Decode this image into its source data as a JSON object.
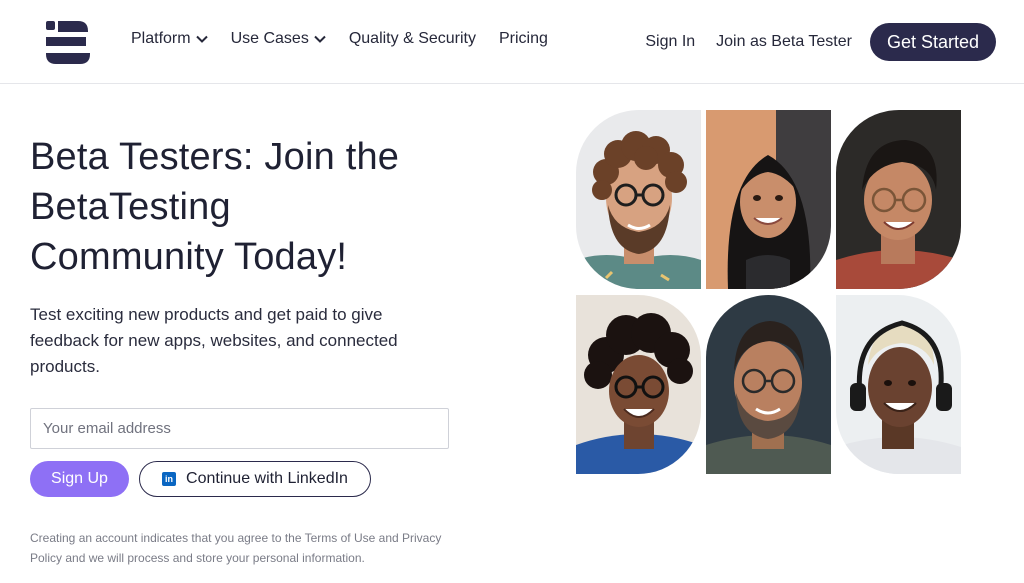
{
  "header": {
    "logo_icon": "betatesting-logo-icon",
    "nav": [
      {
        "label": "Platform",
        "has_dropdown": true
      },
      {
        "label": "Use Cases",
        "has_dropdown": true
      },
      {
        "label": "Quality & Security",
        "has_dropdown": false
      },
      {
        "label": "Pricing",
        "has_dropdown": false
      }
    ],
    "sign_in": "Sign In",
    "join_beta": "Join as Beta Tester",
    "get_started": "Get Started"
  },
  "hero": {
    "title_lines": [
      "Beta Testers: Join the",
      "BetaTesting",
      "Community Today!"
    ],
    "subtitle": "Test exciting new products and get paid to give feedback for new apps, websites, and connected products.",
    "email_placeholder": "Your email address",
    "email_value": "",
    "signup_label": "Sign Up",
    "linkedin_label": "Continue with LinkedIn",
    "linkedin_icon_text": "in",
    "legal": "Creating an account indicates that you agree to the Terms of Use and Privacy Policy and we will process and store your personal information."
  },
  "colors": {
    "brand_dark": "#2b2a4c",
    "accent_purple": "#8e70f5",
    "linkedin_blue": "#0a66c2"
  },
  "photos": [
    {
      "name": "tester-photo-1"
    },
    {
      "name": "tester-photo-2"
    },
    {
      "name": "tester-photo-3"
    },
    {
      "name": "tester-photo-4"
    },
    {
      "name": "tester-photo-5"
    },
    {
      "name": "tester-photo-6"
    }
  ]
}
